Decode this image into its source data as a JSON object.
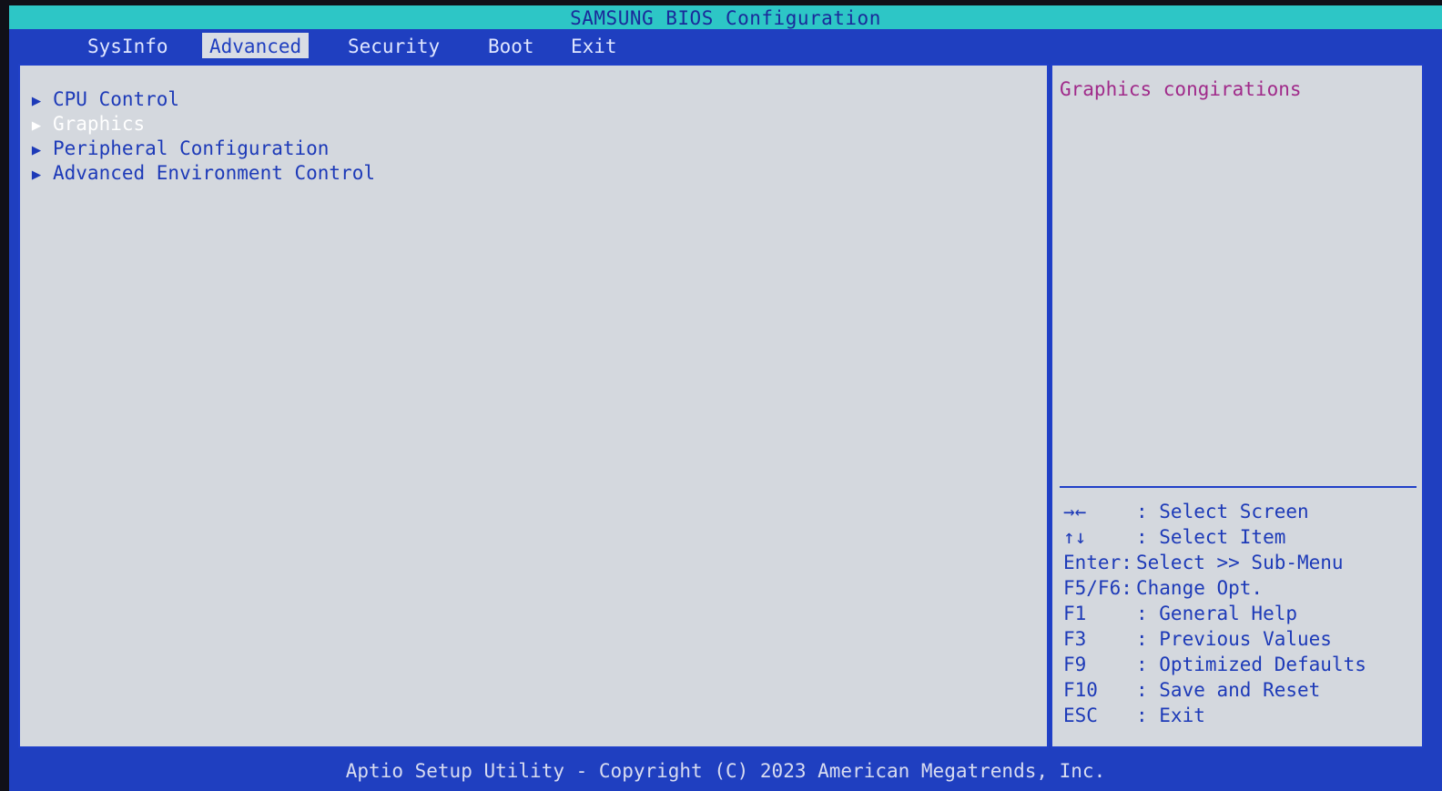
{
  "title": "SAMSUNG BIOS Configuration",
  "tabs": [
    {
      "label": "SysInfo"
    },
    {
      "label": "Advanced"
    },
    {
      "label": "Security"
    },
    {
      "label": "Boot"
    },
    {
      "label": "Exit"
    }
  ],
  "active_tab": "Advanced",
  "menu": {
    "arrow": "▶",
    "items": [
      {
        "label": "CPU Control"
      },
      {
        "label": "Graphics"
      },
      {
        "label": "Peripheral Configuration"
      },
      {
        "label": "Advanced Environment Control"
      }
    ],
    "selected_item": "Graphics"
  },
  "help": {
    "text": "Graphics congirations"
  },
  "keys": [
    {
      "key": "→←",
      "desc": ": Select Screen"
    },
    {
      "key": "↑↓",
      "desc": ": Select Item"
    },
    {
      "key": "Enter:",
      "desc": "Select >> Sub-Menu"
    },
    {
      "key": "F5/F6:",
      "desc": "Change Opt."
    },
    {
      "key": "F1",
      "desc": ": General Help"
    },
    {
      "key": "F3",
      "desc": ": Previous Values"
    },
    {
      "key": "F9",
      "desc": ": Optimized Defaults"
    },
    {
      "key": "F10",
      "desc": ": Save and Reset"
    },
    {
      "key": "ESC",
      "desc": ": Exit"
    }
  ],
  "footer": "Aptio Setup Utility - Copyright (C) 2023 American Megatrends, Inc.",
  "colors": {
    "background_blue": "#1f3fc0",
    "title_bar_cyan": "#2dc6c6",
    "panel_gray": "#d4d8de",
    "text_blue": "#1d3ab8",
    "help_text_magenta": "#a02a8a",
    "selected_text_white": "#ffffff"
  }
}
